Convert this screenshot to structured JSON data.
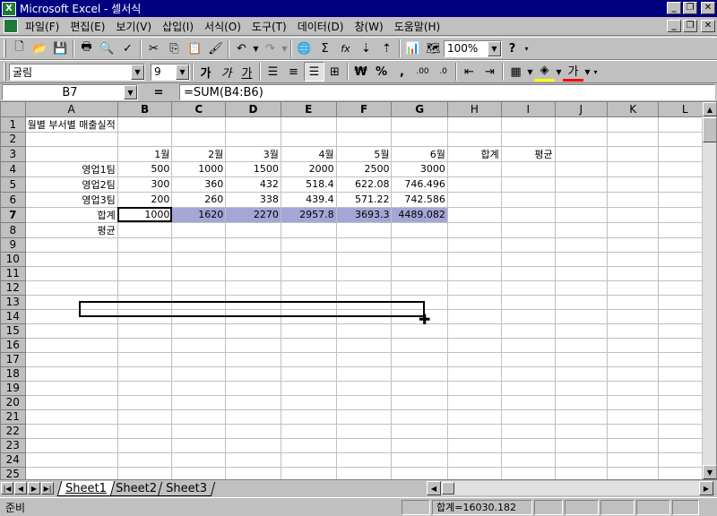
{
  "window": {
    "title": "Microsoft Excel - 셀서식",
    "app_icon": "excel-icon"
  },
  "menu": [
    "파일(F)",
    "편집(E)",
    "보기(V)",
    "삽입(I)",
    "서식(O)",
    "도구(T)",
    "데이터(D)",
    "창(W)",
    "도움말(H)"
  ],
  "toolbar": {
    "zoom": "100%",
    "icons": [
      "new-icon",
      "open-icon",
      "save-icon",
      "print-icon",
      "print-preview-icon",
      "spellcheck-icon",
      "cut-icon",
      "copy-icon",
      "paste-icon",
      "format-painter-icon",
      "undo-icon",
      "redo-icon",
      "hyperlink-icon",
      "autosum-icon",
      "function-icon",
      "sort-ascending-icon",
      "sort-descending-icon",
      "chart-wizard-icon",
      "map-icon",
      "help-icon"
    ],
    "autosum_label": "Σ",
    "function_label": "fx"
  },
  "format_toolbar": {
    "font": "굴림",
    "font_size": "9",
    "bold": "가",
    "italic": "가",
    "underline": "가",
    "currency": "₩",
    "percent": "%",
    "comma": ",",
    "inc_decimal": ".00",
    "dec_decimal": ".0",
    "font_color_label": "가"
  },
  "formula_bar": {
    "name_box": "B7",
    "equals": "=",
    "formula": "=SUM(B4:B6)"
  },
  "columns": [
    "A",
    "B",
    "C",
    "D",
    "E",
    "F",
    "G",
    "H",
    "I",
    "J",
    "K",
    "L"
  ],
  "rows": [
    [
      "월별 부서별 매출실적",
      "",
      "",
      "",
      "",
      "",
      "",
      "",
      "",
      "",
      "",
      ""
    ],
    [
      "",
      "",
      "",
      "",
      "",
      "",
      "",
      "",
      "",
      "",
      "",
      ""
    ],
    [
      "",
      "1월",
      "2월",
      "3월",
      "4월",
      "5월",
      "6월",
      "합계",
      "평균",
      "",
      "",
      ""
    ],
    [
      "영업1팀",
      "500",
      "1000",
      "1500",
      "2000",
      "2500",
      "3000",
      "",
      "",
      "",
      "",
      ""
    ],
    [
      "영업2팀",
      "300",
      "360",
      "432",
      "518.4",
      "622.08",
      "746.496",
      "",
      "",
      "",
      "",
      ""
    ],
    [
      "영업3팀",
      "200",
      "260",
      "338",
      "439.4",
      "571.22",
      "742.586",
      "",
      "",
      "",
      "",
      ""
    ],
    [
      "합계",
      "1000",
      "1620",
      "2270",
      "2957.8",
      "3693.3",
      "4489.082",
      "",
      "",
      "",
      "",
      ""
    ],
    [
      "평균",
      "",
      "",
      "",
      "",
      "",
      "",
      "",
      "",
      "",
      "",
      ""
    ]
  ],
  "total_rows": 26,
  "sheet_tabs": [
    "Sheet1",
    "Sheet2",
    "Sheet3"
  ],
  "active_tab": "Sheet1",
  "status": {
    "mode": "준비",
    "sum": "합계=16030.182"
  }
}
